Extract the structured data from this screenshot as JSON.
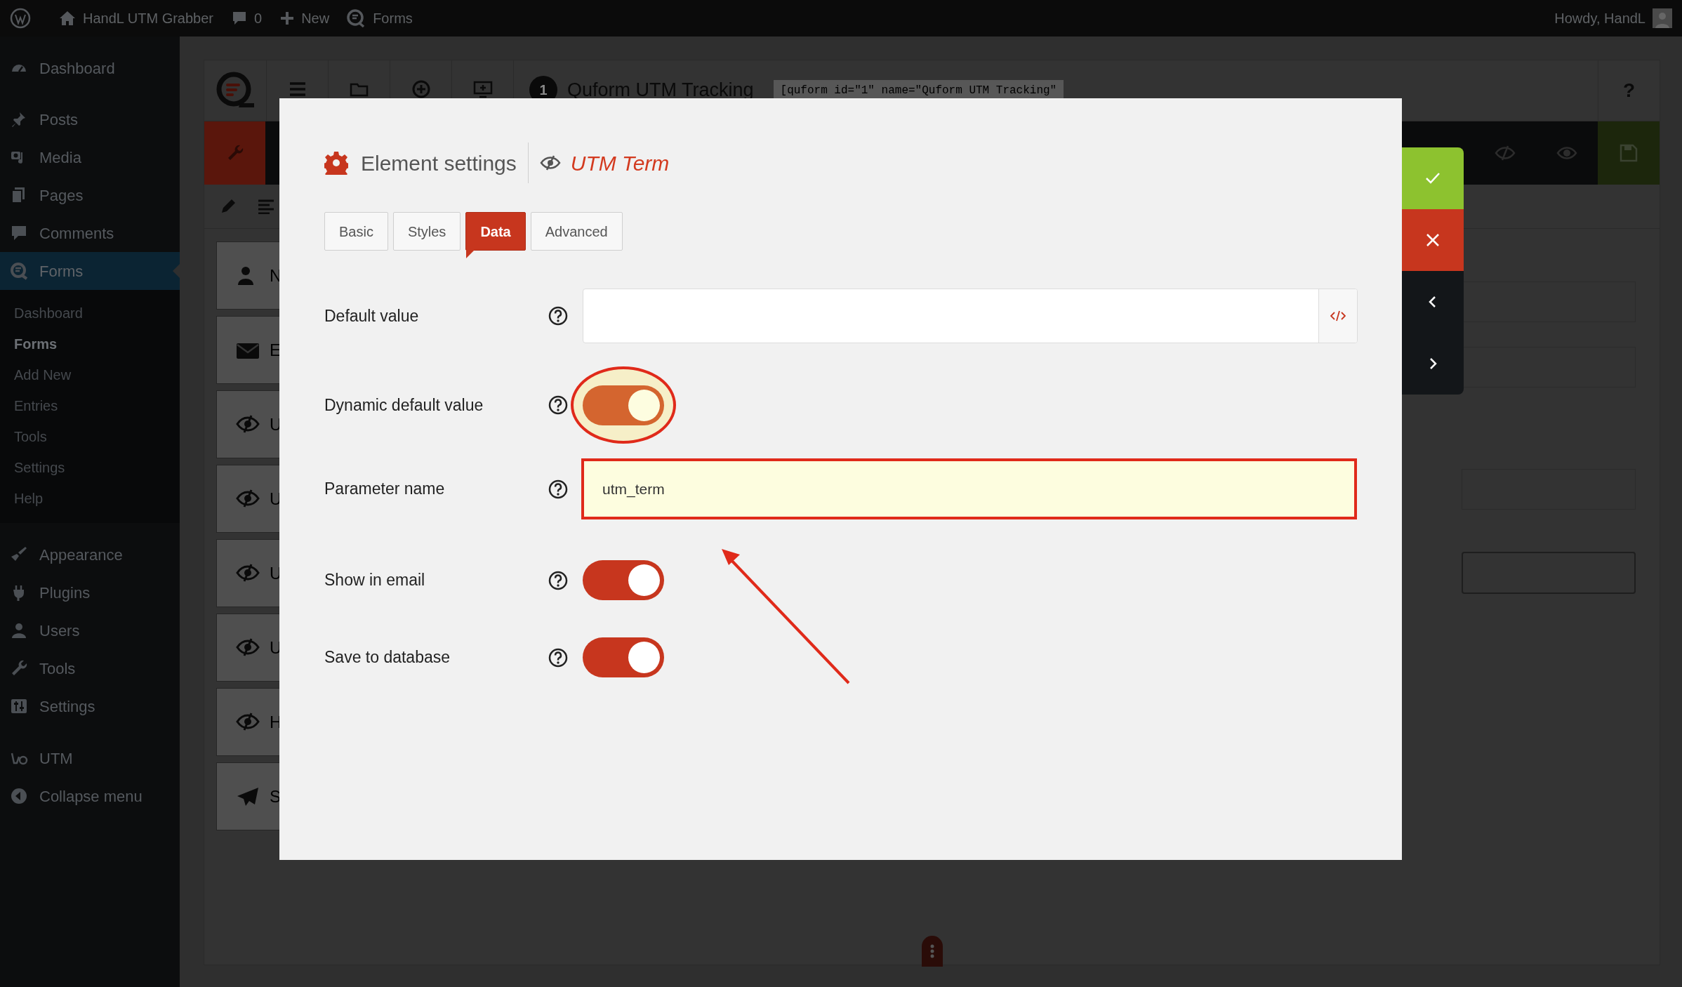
{
  "admin_bar": {
    "site": "HandL UTM Grabber",
    "comments": "0",
    "new": "New",
    "forms": "Forms",
    "greeting": "Howdy, HandL"
  },
  "sidebar": {
    "sections": [
      {
        "items": [
          {
            "kind": "dashboard",
            "label": "Dashboard",
            "selected": false
          }
        ]
      },
      {
        "items": [
          {
            "kind": "pin",
            "label": "Posts",
            "selected": false
          },
          {
            "kind": "media",
            "label": "Media",
            "selected": false
          },
          {
            "kind": "pages",
            "label": "Pages",
            "selected": false
          },
          {
            "kind": "comment",
            "label": "Comments",
            "selected": false
          },
          {
            "kind": "forms",
            "label": "Forms",
            "selected": true,
            "children": [
              {
                "label": "Dashboard",
                "selected": false
              },
              {
                "label": "Forms",
                "selected": true
              },
              {
                "label": "Add New",
                "selected": false
              },
              {
                "label": "Entries",
                "selected": false
              },
              {
                "label": "Tools",
                "selected": false
              },
              {
                "label": "Settings",
                "selected": false
              },
              {
                "label": "Help",
                "selected": false
              }
            ]
          }
        ]
      },
      {
        "items": [
          {
            "kind": "brush",
            "label": "Appearance",
            "selected": false
          },
          {
            "kind": "plug",
            "label": "Plugins",
            "selected": false
          },
          {
            "kind": "user",
            "label": "Users",
            "selected": false
          },
          {
            "kind": "wrench",
            "label": "Tools",
            "selected": false
          },
          {
            "kind": "sliders",
            "label": "Settings",
            "selected": false
          }
        ]
      },
      {
        "items": [
          {
            "kind": "utm",
            "label": "UTM",
            "selected": false
          },
          {
            "kind": "collapse",
            "label": "Collapse menu",
            "selected": false
          }
        ]
      }
    ]
  },
  "builder": {
    "form_number": "1",
    "form_title": "Quform UTM Tracking",
    "shortcode": "[quform id=\"1\" name=\"Quform UTM Tracking\"",
    "help": "?",
    "elements": [
      {
        "kind": "person",
        "label": "N"
      },
      {
        "kind": "envelope",
        "label": "E"
      },
      {
        "kind": "hidden",
        "label": "U"
      },
      {
        "kind": "hidden",
        "label": "U"
      },
      {
        "kind": "hidden",
        "label": "U"
      },
      {
        "kind": "hidden",
        "label": "U"
      },
      {
        "kind": "hidden",
        "label": "H"
      },
      {
        "kind": "plane",
        "label": "S"
      }
    ]
  },
  "modal": {
    "title": "Element settings",
    "element_name": "UTM Term",
    "tabs": [
      {
        "label": "Basic",
        "selected": false
      },
      {
        "label": "Styles",
        "selected": false
      },
      {
        "label": "Data",
        "selected": true
      },
      {
        "label": "Advanced",
        "selected": false
      }
    ],
    "fields": [
      {
        "kind": "code_input",
        "label": "Default value"
      },
      {
        "kind": "toggle",
        "label": "Dynamic default value",
        "on": true,
        "annotated": true
      },
      {
        "kind": "text",
        "label": "Parameter name",
        "value": "utm_term",
        "annotated": true
      },
      {
        "kind": "toggle",
        "label": "Show in email",
        "on": true
      },
      {
        "kind": "toggle",
        "label": "Save to database",
        "on": true
      }
    ],
    "annotation_arrow": true
  }
}
